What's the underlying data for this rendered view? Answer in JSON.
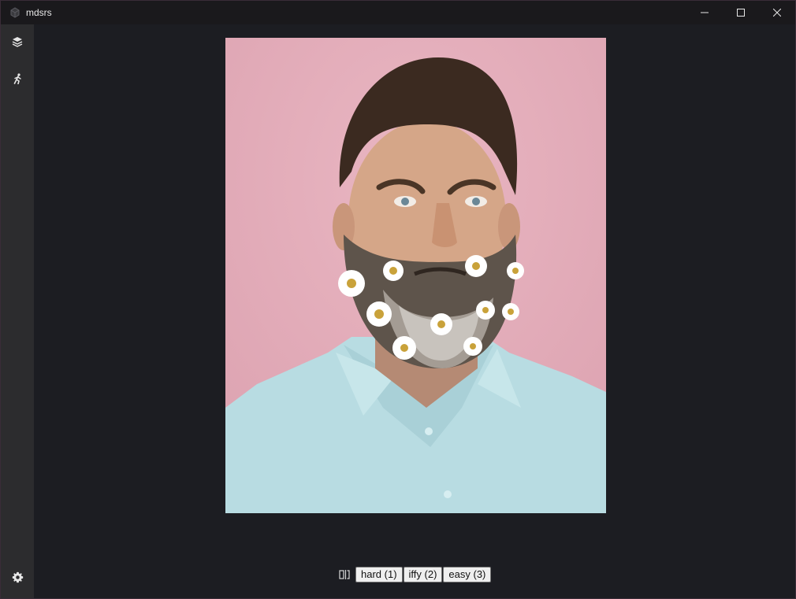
{
  "window": {
    "title": "mdsrs",
    "controls": {
      "minimize_icon": "minimize-icon",
      "maximize_icon": "maximize-icon",
      "close_icon": "close-icon"
    }
  },
  "sidebar": {
    "items": [
      {
        "icon": "layers-icon"
      },
      {
        "icon": "running-person-icon"
      }
    ],
    "footer": {
      "icon": "gear-icon"
    }
  },
  "card": {
    "image_description_icon": "photo",
    "split_icon": "split-view-icon"
  },
  "buttons": {
    "hard": "hard (1)",
    "iffy": "iffy (2)",
    "easy": "easy (3)"
  },
  "colors": {
    "titlebar": "#1a191c",
    "sidebar": "#2c2c2e",
    "background": "#1c1d22",
    "photo_background": "#e5aebb"
  }
}
